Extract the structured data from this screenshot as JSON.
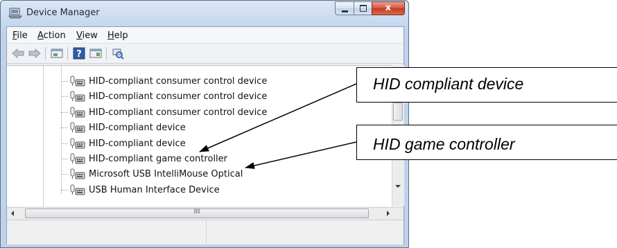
{
  "window": {
    "title": "Device Manager",
    "close_glyph": "x"
  },
  "menu": [
    {
      "label": "File",
      "accel": "F",
      "rest": "ile"
    },
    {
      "label": "Action",
      "accel": "A",
      "rest": "ction"
    },
    {
      "label": "View",
      "accel": "V",
      "rest": "iew"
    },
    {
      "label": "Help",
      "accel": "H",
      "rest": "elp"
    }
  ],
  "toolbar": {
    "icons": [
      "back-arrow-icon",
      "forward-arrow-icon",
      "properties-icon",
      "help-icon",
      "show-hide-console-tree-icon",
      "scan-hardware-changes-icon"
    ]
  },
  "tree": {
    "items": [
      {
        "label": "HID-compliant consumer control device"
      },
      {
        "label": "HID-compliant consumer control device"
      },
      {
        "label": "HID-compliant consumer control device"
      },
      {
        "label": "HID-compliant device"
      },
      {
        "label": "HID-compliant device"
      },
      {
        "label": "HID-compliant game controller"
      },
      {
        "label": "Microsoft USB IntelliMouse Optical"
      },
      {
        "label": "USB Human Interface Device"
      }
    ]
  },
  "scrollbar": {
    "h_grip": "III"
  },
  "callouts": {
    "hid_device": "HID compliant device",
    "game_controller": "HID game controller"
  },
  "colors": {
    "title_bar": "#c5d7ee",
    "close_button": "#c23a22",
    "callout_border": "#000000"
  }
}
